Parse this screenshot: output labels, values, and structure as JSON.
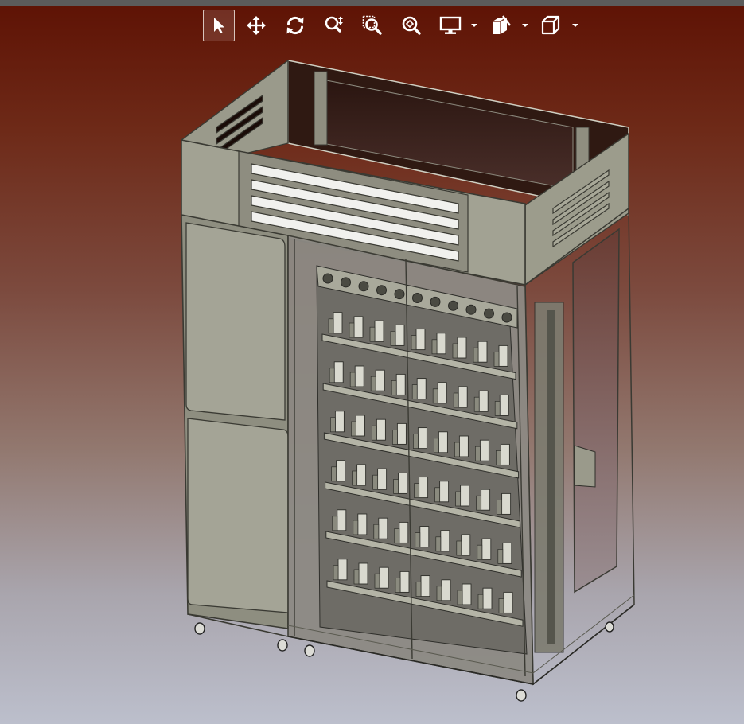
{
  "toolbar": {
    "tools": [
      {
        "id": "select",
        "icon": "cursor-arrow-icon",
        "active": true
      },
      {
        "id": "pan",
        "icon": "pan-move-icon",
        "active": false
      },
      {
        "id": "rotate",
        "icon": "rotate-icon",
        "active": false
      },
      {
        "id": "zoom",
        "icon": "zoom-in-icon",
        "active": false
      },
      {
        "id": "zoom-window",
        "icon": "zoom-window-icon",
        "active": false
      },
      {
        "id": "zoom-fit",
        "icon": "zoom-fit-icon",
        "active": false
      },
      {
        "id": "display",
        "icon": "monitor-icon",
        "dropdown": true
      },
      {
        "id": "section",
        "icon": "section-view-icon",
        "dropdown": true
      },
      {
        "id": "view-cube",
        "icon": "cube-view-icon",
        "dropdown": true
      }
    ],
    "icon_color": "#ffffff",
    "active_border_color": "#d8c4bc"
  },
  "viewport": {
    "background_top": "#5e1204",
    "background_bottom": "#bcbfcc",
    "model": "vending-cabinet-3d-model"
  }
}
